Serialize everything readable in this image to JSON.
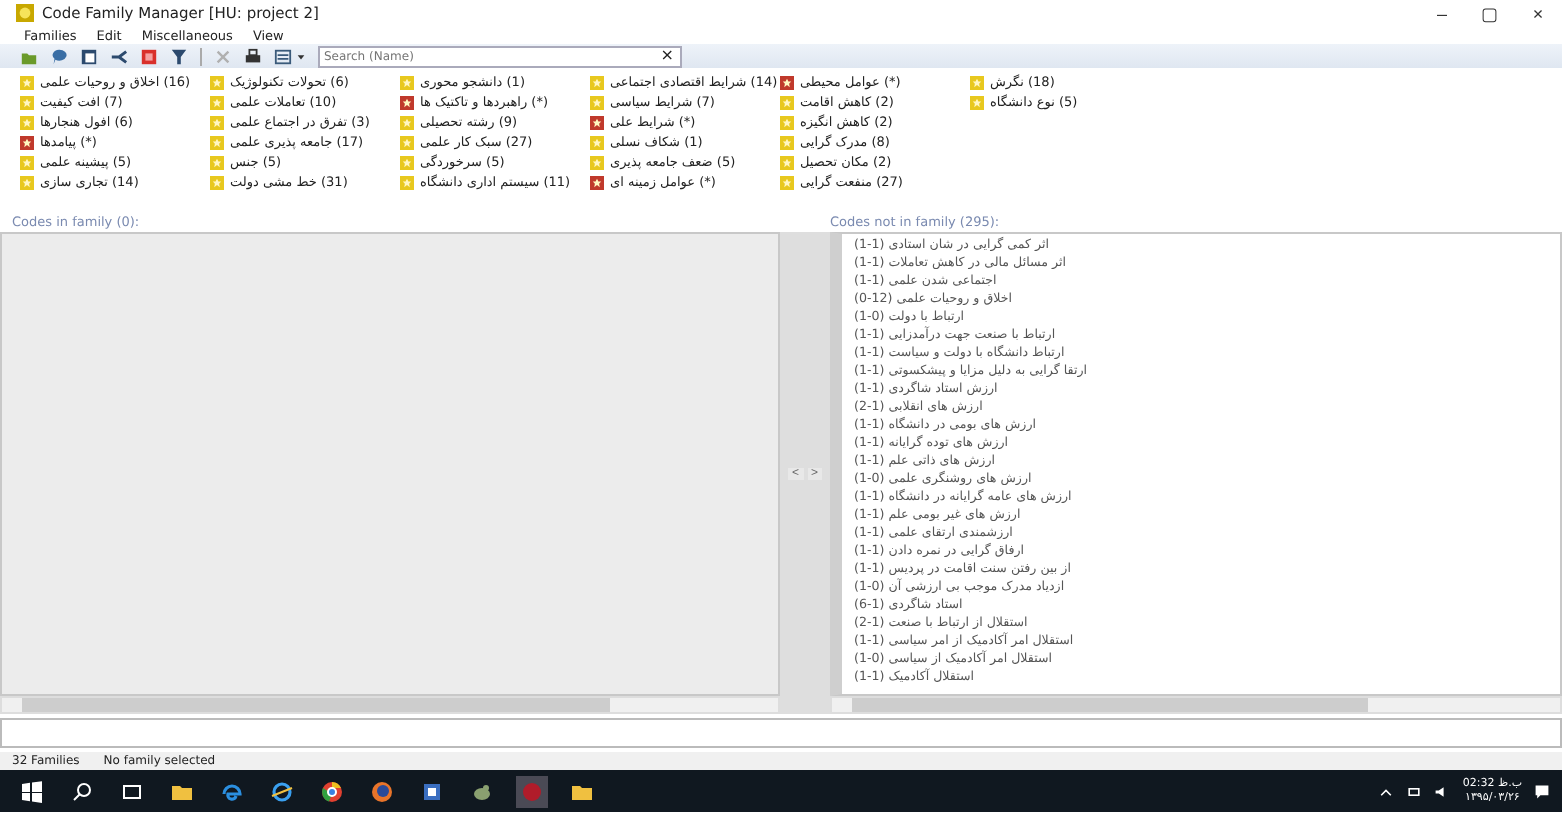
{
  "window": {
    "title": "Code Family Manager [HU: project 2]",
    "minimize": "–",
    "maximize": "▢",
    "close": "×"
  },
  "menu": {
    "families": "Families",
    "edit": "Edit",
    "miscellaneous": "Miscellaneous",
    "view": "View"
  },
  "toolbar": {
    "search": {
      "placeholder": "Search (Name)",
      "clear": "×"
    }
  },
  "family_columns": {
    "column_1": {
      "items": [
        {
          "label": "(16) اخلاق و روحیات علمی",
          "color": "#e8c81e"
        },
        {
          "label": "(7) افت کیفیت",
          "color": "#e8c81e"
        },
        {
          "label": "(6) افول هنجارها",
          "color": "#e8c81e"
        },
        {
          "label": "(*) پیامدها",
          "color": "#c0392b"
        },
        {
          "label": "(5) پیشینه علمی",
          "color": "#e8c81e"
        },
        {
          "label": "(14) تجاری سازی",
          "color": "#e8c81e"
        }
      ]
    },
    "column_2": {
      "items": [
        {
          "label": "(6) تحولات تکنولوژیک",
          "color": "#e8c81e"
        },
        {
          "label": "(10) تعاملات علمی",
          "color": "#e8c81e"
        },
        {
          "label": "(3) تفرق در اجتماع علمی",
          "color": "#e8c81e"
        },
        {
          "label": "(17) جامعه پذیری علمی",
          "color": "#e8c81e"
        },
        {
          "label": "(5) جنس",
          "color": "#e8c81e"
        },
        {
          "label": "(31) خط مشی دولت",
          "color": "#e8c81e"
        }
      ]
    },
    "column_3": {
      "items": [
        {
          "label": "(1) دانشجو محوری",
          "color": "#e8c81e"
        },
        {
          "label": "(*) راهبردها و تاکتیک ها",
          "color": "#c0392b"
        },
        {
          "label": "(9) رشته تحصیلی",
          "color": "#e8c81e"
        },
        {
          "label": "(27) سبک کار علمی",
          "color": "#e8c81e"
        },
        {
          "label": "(5) سرخوردگی",
          "color": "#e8c81e"
        },
        {
          "label": "(11) سیستم اداری دانشگاه",
          "color": "#e8c81e"
        }
      ]
    },
    "column_4": {
      "items": [
        {
          "label": "(14) شرایط اقتصادی اجتماعی",
          "color": "#e8c81e"
        },
        {
          "label": "(7) شرایط سیاسی",
          "color": "#e8c81e"
        },
        {
          "label": "(*) شرایط علی",
          "color": "#c0392b"
        },
        {
          "label": "(1) شکاف نسلی",
          "color": "#e8c81e"
        },
        {
          "label": "(5) ضعف جامعه پذیری",
          "color": "#e8c81e"
        },
        {
          "label": "(*) عوامل زمینه ای",
          "color": "#c0392b"
        }
      ]
    },
    "column_5": {
      "items": [
        {
          "label": "(*) عوامل محیطی",
          "color": "#c0392b"
        },
        {
          "label": "(2) کاهش اقامت",
          "color": "#e8c81e"
        },
        {
          "label": "(2) کاهش انگیزه",
          "color": "#e8c81e"
        },
        {
          "label": "(8) مدرک گرایی",
          "color": "#e8c81e"
        },
        {
          "label": "(2) مکان تحصیل",
          "color": "#e8c81e"
        },
        {
          "label": "(27) منفعت گرایی",
          "color": "#e8c81e"
        }
      ]
    },
    "column_6": {
      "items": [
        {
          "label": "(18) نگرش",
          "color": "#e8c81e"
        },
        {
          "label": "(5) نوع دانشگاه",
          "color": "#e8c81e"
        }
      ]
    }
  },
  "codes_in_family": {
    "header": "Codes in family (0):"
  },
  "transfer_buttons": {
    "remove": "<",
    "add": ">"
  },
  "codes_not_in_family": {
    "header": "Codes not in family (295):",
    "items": [
      "(1-1) اثر کمی گرایی در شان استادی",
      "(1-1) اثر مسائل مالی در کاهش تعاملات",
      "(1-1) اجتماعی شدن علمی",
      "(0-12) اخلاق و روحیات علمی",
      "(1-0) ارتباط با دولت",
      "(1-1) ارتباط با صنعت جهت درآمدزایی",
      "(1-1) ارتباط دانشگاه با دولت و سیاست",
      "(1-1) ارتقا گرایی به دلیل مزایا و پیشکسوتی",
      "(1-1) ارزش استاد شاگردی",
      "(2-1) ارزش های انقلابی",
      "(1-1) ارزش های بومی در دانشگاه",
      "(1-1) ارزش های توده گرایانه",
      "(1-1) ارزش های ذاتی علم",
      "(1-0) ارزش های روشنگری علمی",
      "(1-1) ارزش های عامه گرایانه در دانشگاه",
      "(1-1) ارزش های غیر بومی علم",
      "(1-1) ارزشمندی ارتقای علمی",
      "(1-1) ارفاق گرایی در نمره دادن",
      "(1-1) از بین رفتن سنت اقامت در پردیس",
      "(1-0) ازدیاد مدرک موجب بی ارزشی آن",
      "(6-1) استاد شاگردی",
      "(2-1) استقلال از ارتباط با صنعت",
      "(1-1) استقلال امر آکادمیک از امر سیاسی",
      "(1-0) استقلال امر آکادمیک از سیاسی",
      "(1-1) استقلال آکادمیک"
    ]
  },
  "status_bar": {
    "family_count": "32 Families",
    "selection": "No family selected"
  },
  "taskbar": {
    "time": "02:32 ب.ظ",
    "date": "۱۳۹۵/۰۳/۲۶"
  }
}
